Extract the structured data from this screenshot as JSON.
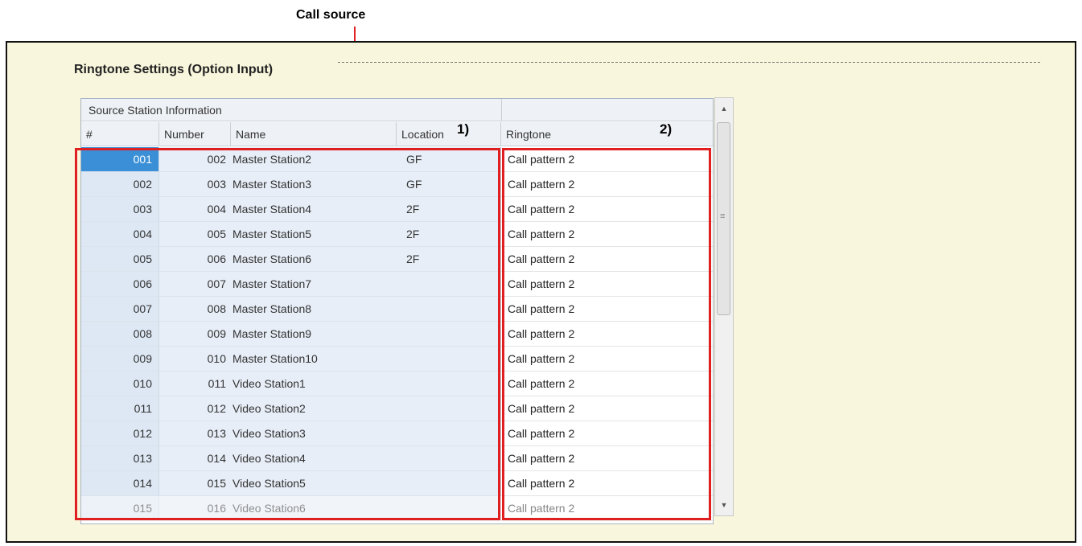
{
  "annotations": {
    "call_source_label": "Call source",
    "marker_1": "1)",
    "marker_2": "2)"
  },
  "section": {
    "title": "Ringtone Settings (Option Input)"
  },
  "table": {
    "group_header": "Source Station Information",
    "columns": {
      "index": "#",
      "number": "Number",
      "name": "Name",
      "location": "Location",
      "ringtone": "Ringtone"
    },
    "rows": [
      {
        "idx": "001",
        "number": "002",
        "name": "Master Station2",
        "location": "GF",
        "ringtone": "Call pattern 2"
      },
      {
        "idx": "002",
        "number": "003",
        "name": "Master Station3",
        "location": "GF",
        "ringtone": "Call pattern 2"
      },
      {
        "idx": "003",
        "number": "004",
        "name": "Master Station4",
        "location": "2F",
        "ringtone": "Call pattern 2"
      },
      {
        "idx": "004",
        "number": "005",
        "name": "Master Station5",
        "location": "2F",
        "ringtone": "Call pattern 2"
      },
      {
        "idx": "005",
        "number": "006",
        "name": "Master Station6",
        "location": "2F",
        "ringtone": "Call pattern 2"
      },
      {
        "idx": "006",
        "number": "007",
        "name": "Master Station7",
        "location": "",
        "ringtone": "Call pattern 2"
      },
      {
        "idx": "007",
        "number": "008",
        "name": "Master Station8",
        "location": "",
        "ringtone": "Call pattern 2"
      },
      {
        "idx": "008",
        "number": "009",
        "name": "Master Station9",
        "location": "",
        "ringtone": "Call pattern 2"
      },
      {
        "idx": "009",
        "number": "010",
        "name": "Master Station10",
        "location": "",
        "ringtone": "Call pattern 2"
      },
      {
        "idx": "010",
        "number": "011",
        "name": "Video Station1",
        "location": "",
        "ringtone": "Call pattern 2"
      },
      {
        "idx": "011",
        "number": "012",
        "name": "Video Station2",
        "location": "",
        "ringtone": "Call pattern 2"
      },
      {
        "idx": "012",
        "number": "013",
        "name": "Video Station3",
        "location": "",
        "ringtone": "Call pattern 2"
      },
      {
        "idx": "013",
        "number": "014",
        "name": "Video Station4",
        "location": "",
        "ringtone": "Call pattern 2"
      },
      {
        "idx": "014",
        "number": "015",
        "name": "Video Station5",
        "location": "",
        "ringtone": "Call pattern 2"
      },
      {
        "idx": "015",
        "number": "016",
        "name": "Video Station6",
        "location": "",
        "ringtone": "Call pattern 2"
      }
    ]
  },
  "scrollbar": {
    "up_icon": "triangle-up-icon",
    "down_icon": "triangle-down-icon"
  }
}
